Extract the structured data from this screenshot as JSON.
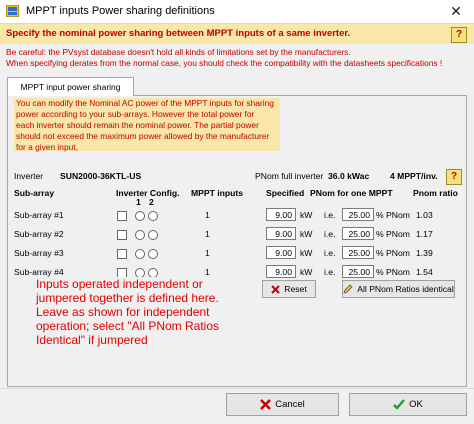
{
  "window": {
    "title": "MPPT inputs Power sharing definitions",
    "close": "✕"
  },
  "header": {
    "text": "Specify the nominal power sharing  between MPPT inputs of a same inverter.",
    "help": "?"
  },
  "warning": {
    "line1": "Be careful:  the PVsyst database doesn't hold all kinds of limitations set by the manufacturers.",
    "line2": "When specifying derates from the normal case, you should check the compatibility with the datasheets specifications !"
  },
  "tab": {
    "label": "MPPT input power sharing"
  },
  "info": {
    "lines": [
      "You can modify the Nominal AC power of the MPPT inputs for sharing",
      "power according to your sub-arrays. However the total power for",
      "each inverter should remain the nominal power. The partial power",
      "should not exceed the maximum power allowed by the manufacturer",
      "for a given input,"
    ]
  },
  "inverter": {
    "label": "Inverter",
    "model": "SUN2000-36KTL-US",
    "pnom_label": "PNom full inverter",
    "pnom_value": "36.0 kWac",
    "mppt": "4 MPPT/inv.",
    "help": "?"
  },
  "columns": {
    "subarray": "Sub-array",
    "config": "Inverter Config.",
    "config_1": "1",
    "config_2": "2",
    "mppt_inputs": "MPPT inputs",
    "specified": "Specified",
    "pnom_for_one": "PNom for one MPPT",
    "pnom_ratio": "Pnom ratio"
  },
  "rows": [
    {
      "name": "Sub-array #1",
      "mppt": "1",
      "kw": "9.00",
      "kw_unit": "kW",
      "ie": "i.e.",
      "pct": "25.00",
      "pct_unit": "% PNom",
      "ratio": "1.03"
    },
    {
      "name": "Sub-array #2",
      "mppt": "1",
      "kw": "9.00",
      "kw_unit": "kW",
      "ie": "i.e.",
      "pct": "25.00",
      "pct_unit": "% PNom",
      "ratio": "1.17"
    },
    {
      "name": "Sub-array #3",
      "mppt": "1",
      "kw": "9.00",
      "kw_unit": "kW",
      "ie": "i.e.",
      "pct": "25.00",
      "pct_unit": "% PNom",
      "ratio": "1.39"
    },
    {
      "name": "Sub-array #4",
      "mppt": "1",
      "kw": "9.00",
      "kw_unit": "kW",
      "ie": "i.e.",
      "pct": "25.00",
      "pct_unit": "% PNom",
      "ratio": "1.54"
    }
  ],
  "buttons": {
    "reset": "Reset",
    "all_identical": "All PNom Ratios identical",
    "cancel": "Cancel",
    "ok": "OK"
  },
  "annotation": {
    "lines": [
      "Inputs operated independent or",
      "jumpered together is defined here.",
      "Leave as shown for independent",
      "operation; select \"All PNom Ratios",
      "Identical\" if jumpered"
    ]
  },
  "colors": {
    "accent_red": "#c00000",
    "info_bg": "#f8e7a8",
    "annotation_red": "#e00000"
  }
}
